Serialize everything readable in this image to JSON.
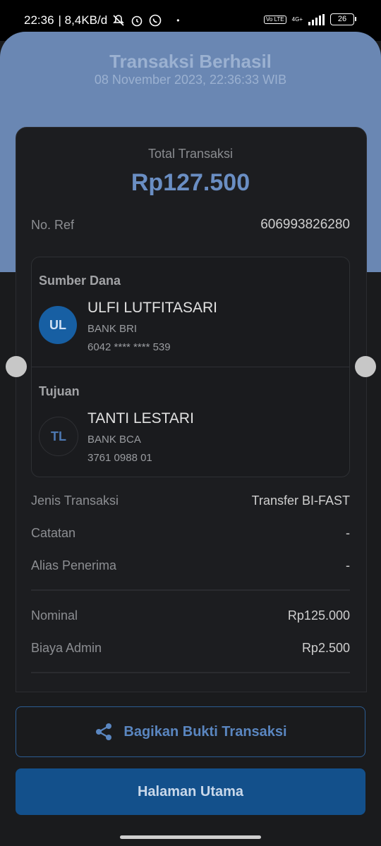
{
  "status_bar": {
    "time": "22:36",
    "speed": "| 8,4KB/d",
    "network": "4G+",
    "volte": "Vo LTE",
    "battery": "26"
  },
  "header": {
    "title": "Transaksi Berhasil",
    "datetime": "08 November 2023, 22:36:33 WIB"
  },
  "summary": {
    "total_label": "Total Transaksi",
    "total_amount": "Rp127.500",
    "ref_label": "No. Ref",
    "ref_value": "606993826280"
  },
  "source": {
    "section_title": "Sumber Dana",
    "initials": "UL",
    "name": "ULFI LUTFITASARI",
    "bank": "BANK BRI",
    "account": "6042 **** **** 539"
  },
  "destination": {
    "section_title": "Tujuan",
    "initials": "TL",
    "name": "TANTI LESTARI",
    "bank": "BANK BCA",
    "account": "3761 0988 01"
  },
  "details": [
    {
      "label": "Jenis Transaksi",
      "value": "Transfer BI-FAST"
    },
    {
      "label": "Catatan",
      "value": "-"
    },
    {
      "label": "Alias Penerima",
      "value": "-"
    }
  ],
  "costs": [
    {
      "label": "Nominal",
      "value": "Rp125.000"
    },
    {
      "label": "Biaya Admin",
      "value": "Rp2.500"
    }
  ],
  "actions": {
    "share_label": "Bagikan Bukti Transaksi",
    "home_label": "Halaman Utama"
  },
  "colors": {
    "header_bg": "#6a87b3",
    "accent": "#6a8ec3",
    "primary_button": "#13508b"
  },
  "icons": [
    "mute-icon",
    "alarm-icon",
    "whatsapp-icon",
    "share-icon"
  ]
}
